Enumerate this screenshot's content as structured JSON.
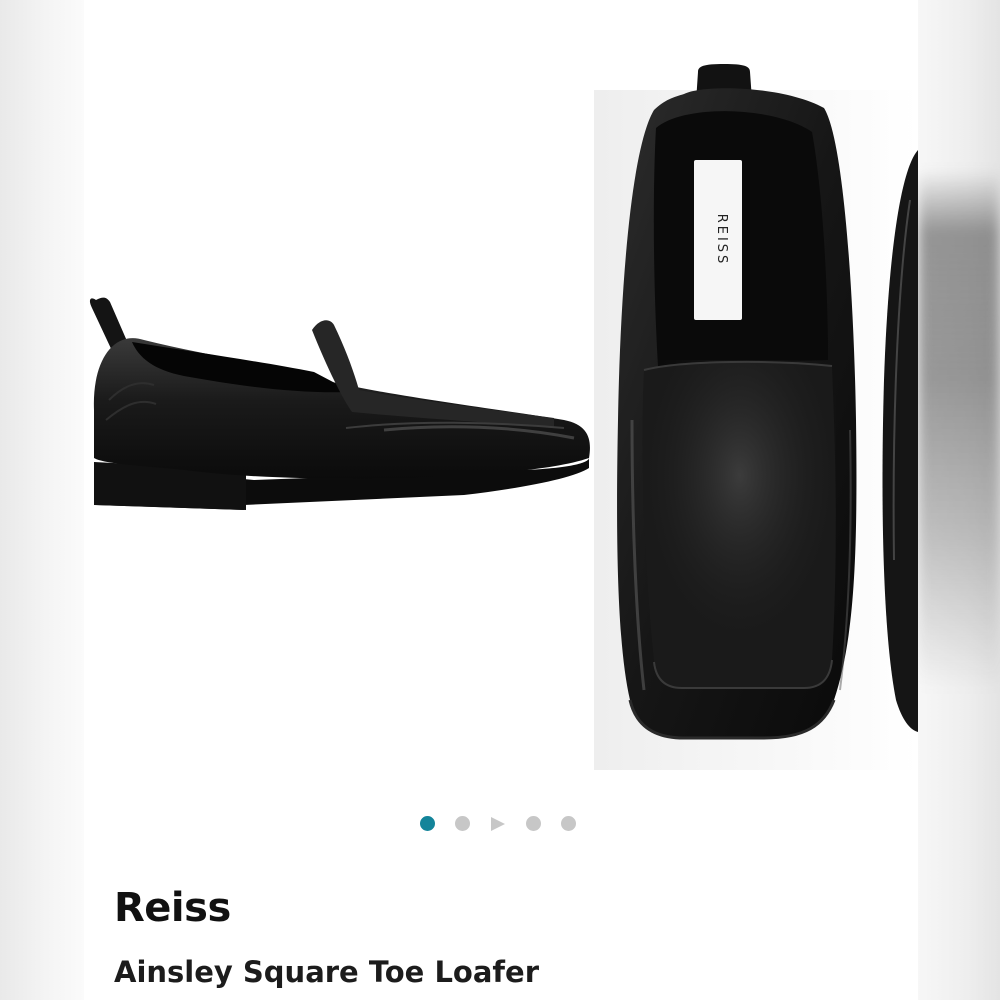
{
  "product": {
    "brand": "Reiss",
    "name": "Ainsley Square Toe Loafer",
    "label_text": "REISS"
  },
  "carousel": {
    "items": [
      "image",
      "image",
      "video",
      "image",
      "image"
    ],
    "active_index": 0,
    "active_color": "#13849a",
    "inactive_color": "#c7c7c7"
  }
}
